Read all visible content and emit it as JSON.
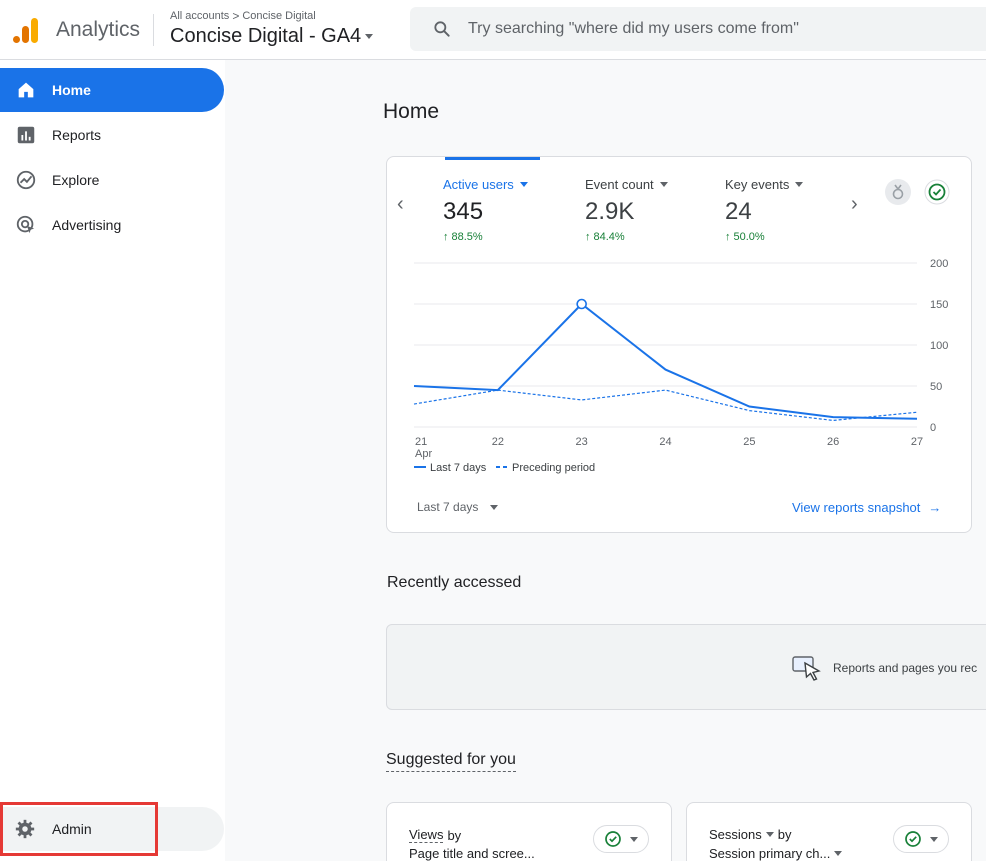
{
  "header": {
    "brand": "Analytics",
    "breadcrumb": {
      "all_accounts": "All accounts",
      "chevron": ">",
      "account": "Concise Digital"
    },
    "property": "Concise Digital - GA4",
    "search_placeholder": "Try searching \"where did my users come from\""
  },
  "sidebar": {
    "items": [
      {
        "label": "Home",
        "icon": "home-icon",
        "active": true
      },
      {
        "label": "Reports",
        "icon": "bar-chart-icon",
        "active": false
      },
      {
        "label": "Explore",
        "icon": "explore-icon",
        "active": false
      },
      {
        "label": "Advertising",
        "icon": "advertising-icon",
        "active": false
      }
    ],
    "admin_label": "Admin"
  },
  "main": {
    "title": "Home",
    "metrics": [
      {
        "label": "Active users",
        "value": "345",
        "delta": "88.5%"
      },
      {
        "label": "Event count",
        "value": "2.9K",
        "delta": "84.4%"
      },
      {
        "label": "Key events",
        "value": "24",
        "delta": "50.0%"
      }
    ],
    "range_label": "Last 7 days",
    "snapshot_link": "View reports snapshot",
    "recent_title": "Recently accessed",
    "recent_text": "Reports and pages you rec",
    "suggested_title": "Suggested for you",
    "suggested_cards": [
      {
        "metric": "Views",
        "by": "by",
        "dimension": "Page title and scree..."
      },
      {
        "metric": "Sessions",
        "by": "by",
        "dimension": "Session primary ch..."
      }
    ]
  },
  "chart_data": {
    "type": "line",
    "x": [
      "21",
      "22",
      "23",
      "24",
      "25",
      "26",
      "27"
    ],
    "x_sublabel": "Apr",
    "ylim": [
      0,
      200
    ],
    "yticks": [
      "0",
      "50",
      "100",
      "150",
      "200"
    ],
    "series": [
      {
        "name": "Last 7 days",
        "values": [
          50,
          45,
          150,
          70,
          25,
          12,
          10
        ],
        "style": "solid",
        "color": "#1a73e8"
      },
      {
        "name": "Preceding period",
        "values": [
          28,
          45,
          33,
          45,
          20,
          8,
          18
        ],
        "style": "dashed",
        "color": "#1a73e8"
      }
    ],
    "legend_position": "bottom-left"
  },
  "colors": {
    "accent": "#1a73e8",
    "positive": "#188038",
    "highlight": "#e53935"
  }
}
